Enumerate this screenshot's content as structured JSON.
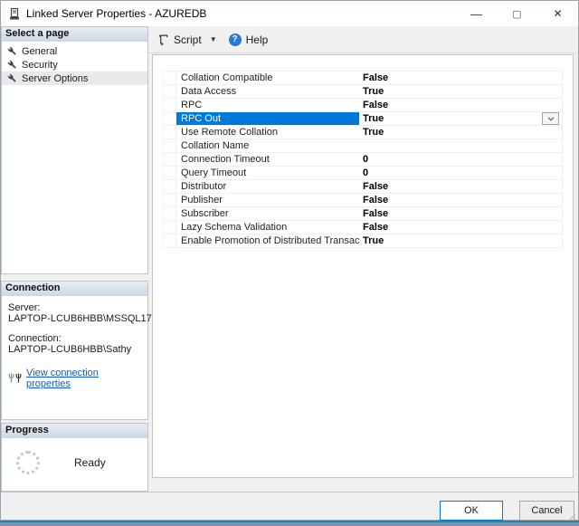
{
  "window": {
    "title": "Linked Server Properties - AZUREDB",
    "minimize_glyph": "—",
    "maximize_glyph": "▢",
    "close_glyph": "✕"
  },
  "toolbar": {
    "script_label": "Script",
    "script_caret": "▼",
    "help_glyph": "?",
    "help_label": "Help"
  },
  "sidebar": {
    "select_page": {
      "header": "Select a page",
      "items": [
        {
          "label": "General",
          "selected": false
        },
        {
          "label": "Security",
          "selected": false
        },
        {
          "label": "Server Options",
          "selected": true
        }
      ]
    },
    "connection": {
      "header": "Connection",
      "server_label": "Server:",
      "server_value": "LAPTOP-LCUB6HBB\\MSSQL17",
      "connection_label": "Connection:",
      "connection_value": "LAPTOP-LCUB6HBB\\Sathy",
      "link_label": "View connection properties"
    },
    "progress": {
      "header": "Progress",
      "status": "Ready"
    }
  },
  "grid": {
    "selected_index": 3,
    "rows": [
      {
        "name": "Collation Compatible",
        "value": "False"
      },
      {
        "name": "Data Access",
        "value": "True"
      },
      {
        "name": "RPC",
        "value": "False"
      },
      {
        "name": "RPC Out",
        "value": "True"
      },
      {
        "name": "Use Remote Collation",
        "value": "True"
      },
      {
        "name": "Collation Name",
        "value": ""
      },
      {
        "name": "Connection Timeout",
        "value": "0"
      },
      {
        "name": "Query Timeout",
        "value": "0"
      },
      {
        "name": "Distributor",
        "value": "False"
      },
      {
        "name": "Publisher",
        "value": "False"
      },
      {
        "name": "Subscriber",
        "value": "False"
      },
      {
        "name": "Lazy Schema Validation",
        "value": "False"
      },
      {
        "name": "Enable Promotion of Distributed Transactions",
        "value": "True"
      }
    ]
  },
  "footer": {
    "ok_label": "OK",
    "cancel_label": "Cancel"
  },
  "colors": {
    "selection_blue": "#0078d7",
    "link_blue": "#0b5bd3",
    "help_blue": "#2b79d7",
    "taskbar_accent": "#2e7ea6",
    "taskbar_body": "#8095a9"
  }
}
